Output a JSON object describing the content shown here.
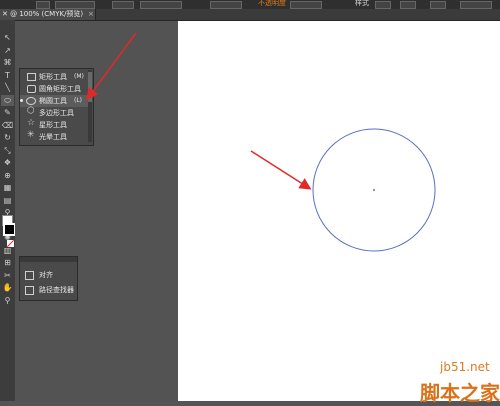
{
  "topbar": {
    "right_label_1": "不透明度",
    "right_label_2": "样式"
  },
  "document": {
    "tab_title": "✕ @ 100% (CMYK/预览)",
    "close_glyph": "×"
  },
  "tools": [
    {
      "name": "selection-tool",
      "glyph": "↖"
    },
    {
      "name": "direct-selection-tool",
      "glyph": "↗"
    },
    {
      "name": "lasso-tool",
      "glyph": "⌘"
    },
    {
      "name": "type-tool",
      "glyph": "T"
    },
    {
      "name": "line-tool",
      "glyph": "╲"
    },
    {
      "name": "ellipse-tool",
      "glyph": "⬭"
    },
    {
      "name": "brush-tool",
      "glyph": "✎"
    },
    {
      "name": "eraser-tool",
      "glyph": "⌫"
    },
    {
      "name": "rotate-tool",
      "glyph": "↻"
    },
    {
      "name": "scale-tool",
      "glyph": "⤡"
    },
    {
      "name": "warp-tool",
      "glyph": "❖"
    },
    {
      "name": "shape-builder-tool",
      "glyph": "⊕"
    },
    {
      "name": "mesh-tool",
      "glyph": "▦"
    },
    {
      "name": "gradient-tool",
      "glyph": "▤"
    },
    {
      "name": "eyedropper-tool",
      "glyph": "⚲"
    },
    {
      "name": "blend-tool",
      "glyph": "◎"
    },
    {
      "name": "symbol-sprayer-tool",
      "glyph": "✺"
    },
    {
      "name": "graph-tool",
      "glyph": "▥"
    },
    {
      "name": "artboard-tool",
      "glyph": "⊞"
    },
    {
      "name": "slice-tool",
      "glyph": "✂"
    },
    {
      "name": "hand-tool",
      "glyph": "✋"
    },
    {
      "name": "zoom-tool",
      "glyph": "⚲"
    }
  ],
  "flyout": {
    "items": [
      {
        "label": "矩形工具",
        "shortcut": "(M)"
      },
      {
        "label": "圆角矩形工具",
        "shortcut": ""
      },
      {
        "label": "椭圆工具",
        "shortcut": "(L)"
      },
      {
        "label": "多边形工具",
        "shortcut": ""
      },
      {
        "label": "星形工具",
        "shortcut": ""
      },
      {
        "label": "光晕工具",
        "shortcut": ""
      }
    ]
  },
  "panel": {
    "items": [
      {
        "label": "对齐"
      },
      {
        "label": "路径查找器"
      }
    ]
  },
  "watermark": {
    "site": "jb51.net",
    "brand": "脚本之家"
  },
  "colors": {
    "arrow": "#e02a2a",
    "circle_stroke": "#5b6fc4",
    "watermark": "#e07a1e"
  }
}
